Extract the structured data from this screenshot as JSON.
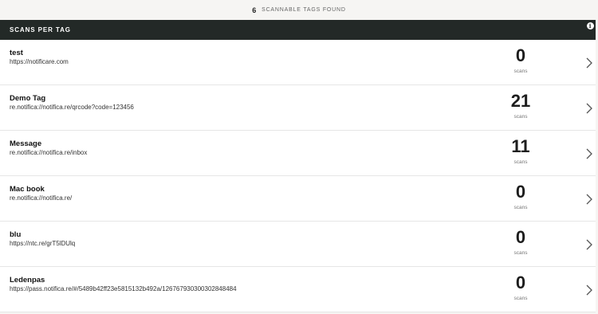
{
  "summary": {
    "count": "6",
    "label": "SCANNABLE TAGS FOUND"
  },
  "panel": {
    "title": "SCANS PER TAG",
    "info_icon": "i"
  },
  "rows": [
    {
      "name": "test",
      "url": "https://notificare.com",
      "scans": "0",
      "unit": "scans"
    },
    {
      "name": "Demo Tag",
      "url": "re.notifica://notifica.re/qrcode?code=123456",
      "scans": "21",
      "unit": "scans"
    },
    {
      "name": "Message",
      "url": "re.notifica://notifica.re/inbox",
      "scans": "11",
      "unit": "scans"
    },
    {
      "name": "Mac book",
      "url": "re.notifica://notifica.re/",
      "scans": "0",
      "unit": "scans"
    },
    {
      "name": "blu",
      "url": "https://ntc.re/grT5lDUlq",
      "scans": "0",
      "unit": "scans"
    },
    {
      "name": "Ledenpas",
      "url": "https://pass.notifica.re/#/5489b42ff23e5815132b492a/12676793030030284848​4",
      "scans": "0",
      "unit": "scans"
    }
  ],
  "colors": {
    "header_bg": "#232927",
    "page_bg": "#f6f5f3"
  }
}
